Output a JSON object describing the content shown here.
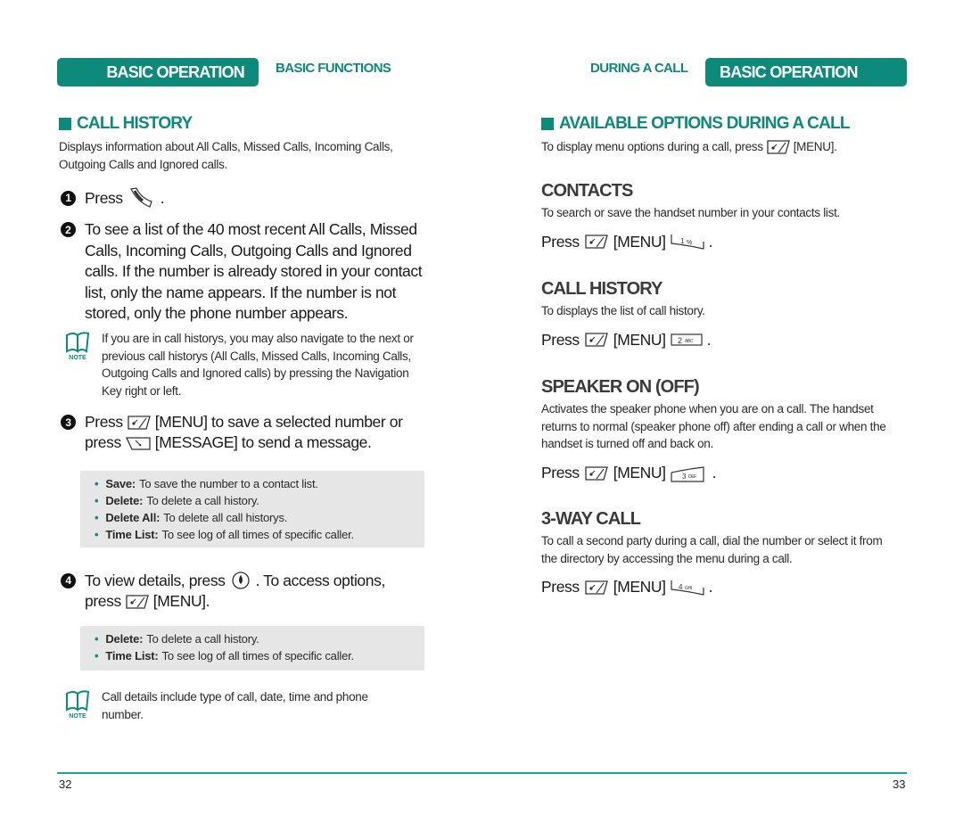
{
  "header": {
    "left_tab_filled": "BASIC OPERATION",
    "left_tab_text": "BASIC FUNCTIONS",
    "right_tab_text": "DURING A CALL",
    "right_tab_filled": "BASIC OPERATION"
  },
  "colors": {
    "accent": "#0e8a7a",
    "rule": "#1aa79a",
    "box_bg": "#e6e6e6"
  },
  "left": {
    "title": "CALL HISTORY",
    "intro": "Displays information about All Calls, Missed Calls, Incoming Calls, Outgoing Calls and Ignored calls.",
    "step1": {
      "num": "1",
      "press": "Press",
      "icon": "send-key-icon",
      "after": "."
    },
    "step2": {
      "num": "2",
      "text": "To see a list of the 40 most recent All Calls, Missed Calls, Incoming Calls, Outgoing Calls and Ignored calls. If the number is already stored in your contact list, only the name appears. If the number is not stored, only the phone number appears."
    },
    "note1": {
      "label": "NOTE",
      "text": "If you are in call historys, you may also navigate to the next or previous call historys (All Calls, Missed Calls, Incoming Calls, Outgoing Calls and Ignored calls) by pressing the Navigation Key right or left."
    },
    "step3": {
      "num": "3",
      "line1_pre": "Press",
      "line1_post": "[MENU] to save a selected number or",
      "line2_pre": "press",
      "line2_post": "[MESSAGE] to send a message."
    },
    "box1": [
      {
        "term": "Save:",
        "desc": "To save the number to a contact list."
      },
      {
        "term": "Delete:",
        "desc": "To delete a call history."
      },
      {
        "term": "Delete All:",
        "desc": "To delete all call historys."
      },
      {
        "term": "Time List:",
        "desc": "To see log of all times of specific caller."
      }
    ],
    "step4": {
      "num": "4",
      "line1_pre": "To view details, press",
      "line1_post": ". To access options,",
      "line2_pre": "press",
      "line2_post": "[MENU]."
    },
    "box2": [
      {
        "term": "Delete:",
        "desc": "To delete a call history."
      },
      {
        "term": "Time List:",
        "desc": "To see log of all times of specific caller."
      }
    ],
    "note2": {
      "label": "NOTE",
      "text": "Call details include type of call, date, time and phone number."
    },
    "page_number": "32"
  },
  "right": {
    "title": "AVAILABLE OPTIONS DURING A CALL",
    "intro_pre": "To display menu options during a call, press",
    "intro_post": "[MENU].",
    "sections": [
      {
        "heading": "CONTACTS",
        "desc": "To search or save the handset number in your contacts list.",
        "press": "Press",
        "menu": "[MENU]",
        "key": "1",
        "after": "."
      },
      {
        "heading": "CALL HISTORY",
        "desc": "To displays the list of call history.",
        "press": "Press",
        "menu": "[MENU]",
        "key": "2",
        "after": "."
      },
      {
        "heading": "SPEAKER ON (OFF)",
        "desc": "Activates the speaker phone when you are on a call. The handset returns to normal (speaker phone off) after ending a call or when the handset is turned off and back on.",
        "press": "Press",
        "menu": "[MENU]",
        "key": "3",
        "after": "."
      },
      {
        "heading": "3-WAY CALL",
        "desc": "To call a second party during a call, dial the number or select it from the directory by accessing the menu during a call.",
        "press": "Press",
        "menu": "[MENU]",
        "key": "4",
        "after": "."
      }
    ],
    "page_number": "33"
  }
}
